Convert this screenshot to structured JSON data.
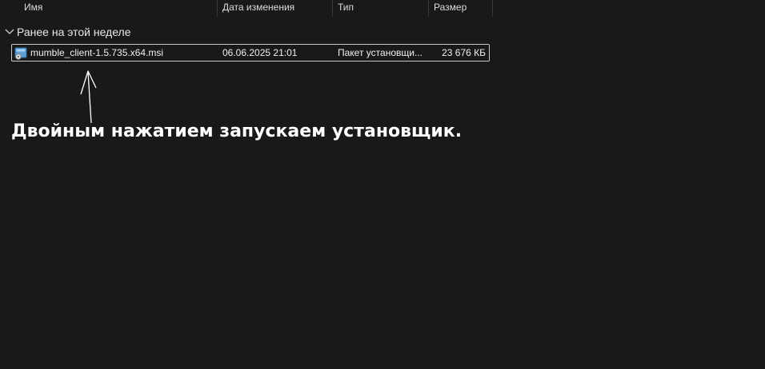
{
  "columns": {
    "name": "Имя",
    "date": "Дата изменения",
    "type": "Тип",
    "size": "Размер"
  },
  "group": {
    "label": "Ранее на этой неделе",
    "expanded": true
  },
  "files": [
    {
      "name": "mumble_client-1.5.735.x64.msi",
      "date": "06.06.2025 21:01",
      "type": "Пакет установщи...",
      "size": "23 676 КБ",
      "icon": "msi-installer-icon",
      "selected": true
    }
  ],
  "annotation": {
    "text": "Двойным нажатием запускаем установщик."
  },
  "colors": {
    "background": "#191919",
    "selection_border": "#c8c8c8",
    "text": "#ffffff"
  }
}
